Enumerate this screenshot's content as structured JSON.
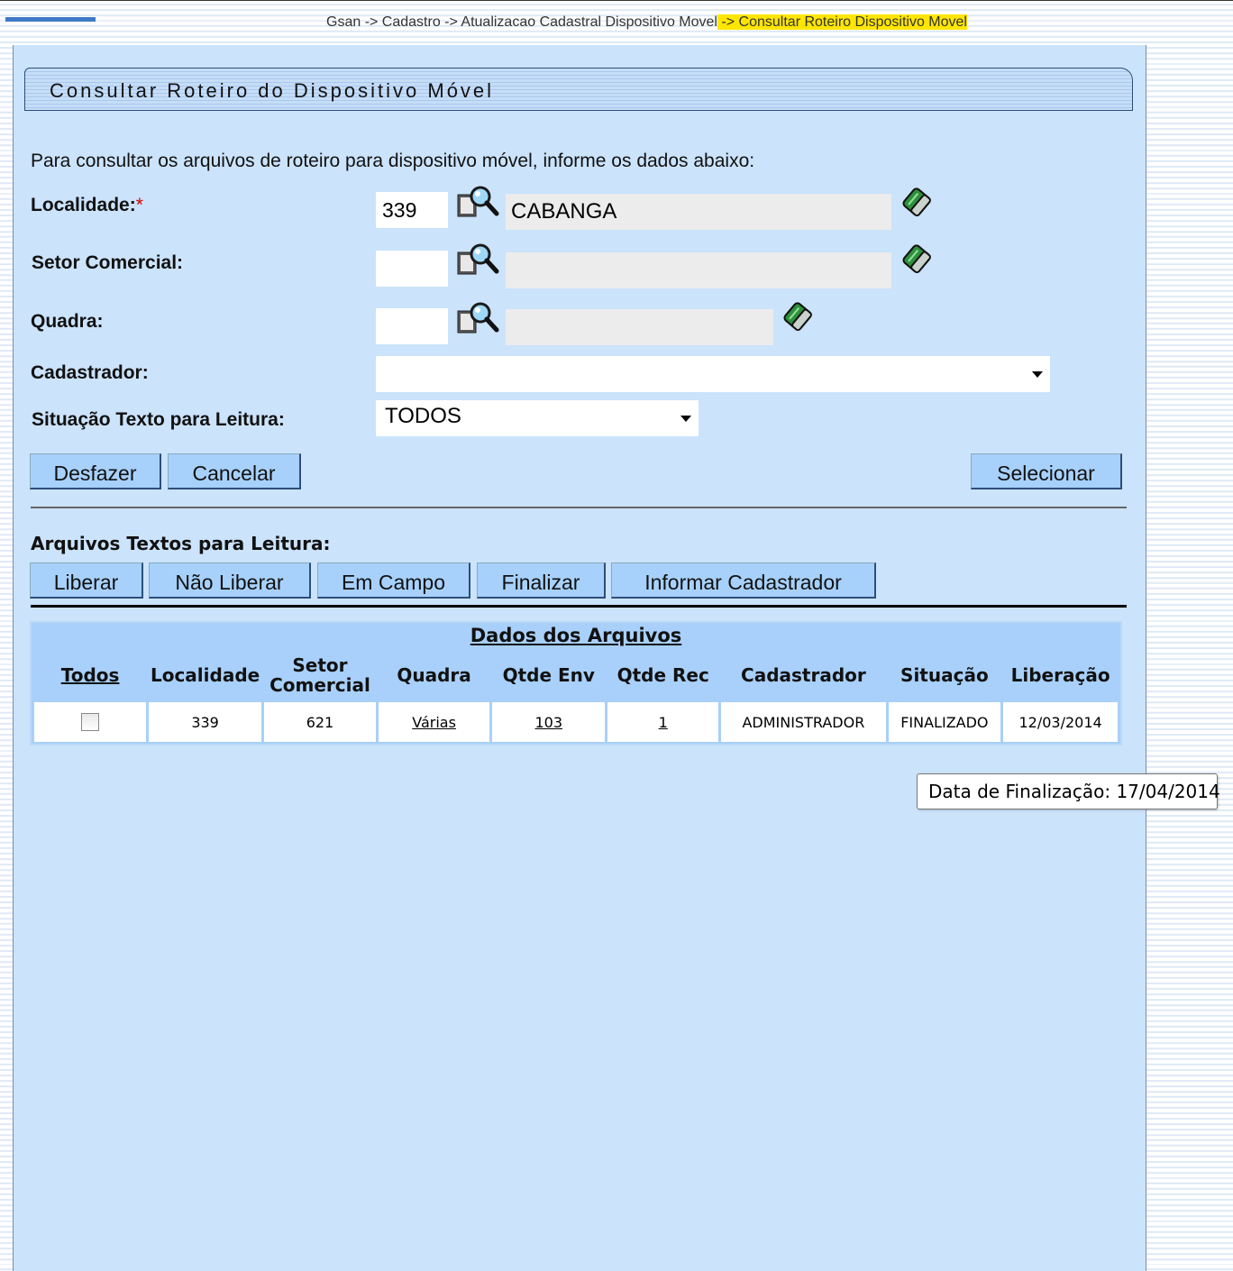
{
  "breadcrumb": {
    "part1": "Gsan -> Cadastro -> Atualizacao Cadastral Dispositivo Movel",
    "part2": " -> Consultar Roteiro Dispositivo Movel"
  },
  "page": {
    "title": "Consultar Roteiro do Dispositivo Móvel",
    "intro": "Para consultar os arquivos de roteiro para dispositivo móvel, informe os dados abaixo:"
  },
  "form": {
    "localidade_label": "Localidade:",
    "required_mark": "*",
    "localidade_code": "339",
    "localidade_name": "CABANGA",
    "setor_label": "Setor Comercial:",
    "setor_code": "",
    "setor_name": "",
    "quadra_label": "Quadra:",
    "quadra_code": "",
    "quadra_name": "",
    "cadastrador_label": "Cadastrador:",
    "cadastrador_value": "",
    "situacao_label": "Situação Texto para Leitura:",
    "situacao_value": "TODOS"
  },
  "buttons": {
    "desfazer": "Desfazer",
    "cancelar": "Cancelar",
    "selecionar": "Selecionar",
    "liberar": "Liberar",
    "nao_liberar": "Não Liberar",
    "em_campo": "Em Campo",
    "finalizar": "Finalizar",
    "informar_cadastrador": "Informar Cadastrador"
  },
  "section_title": "Arquivos Textos para Leitura:",
  "table": {
    "caption": "Dados dos Arquivos",
    "headers": {
      "todos": "Todos",
      "localidade": "Localidade",
      "setor_l1": "Setor",
      "setor_l2": "Comercial",
      "quadra": "Quadra",
      "qtde_env": "Qtde Env",
      "qtde_rec": "Qtde Rec",
      "cadastrador": "Cadastrador",
      "situacao": "Situação",
      "liberacao": "Liberação"
    },
    "rows": [
      {
        "localidade": "339",
        "setor": "621",
        "quadra": "Várias",
        "qtde_env": "103",
        "qtde_rec": "1",
        "cadastrador": "ADMINISTRADOR",
        "situacao": "FINALIZADO",
        "liberacao": "12/03/2014"
      }
    ]
  },
  "tooltip": "Data de Finalização: 17/04/2014",
  "icons": {
    "search": "magnifier-icon",
    "clear": "eraser-icon"
  }
}
